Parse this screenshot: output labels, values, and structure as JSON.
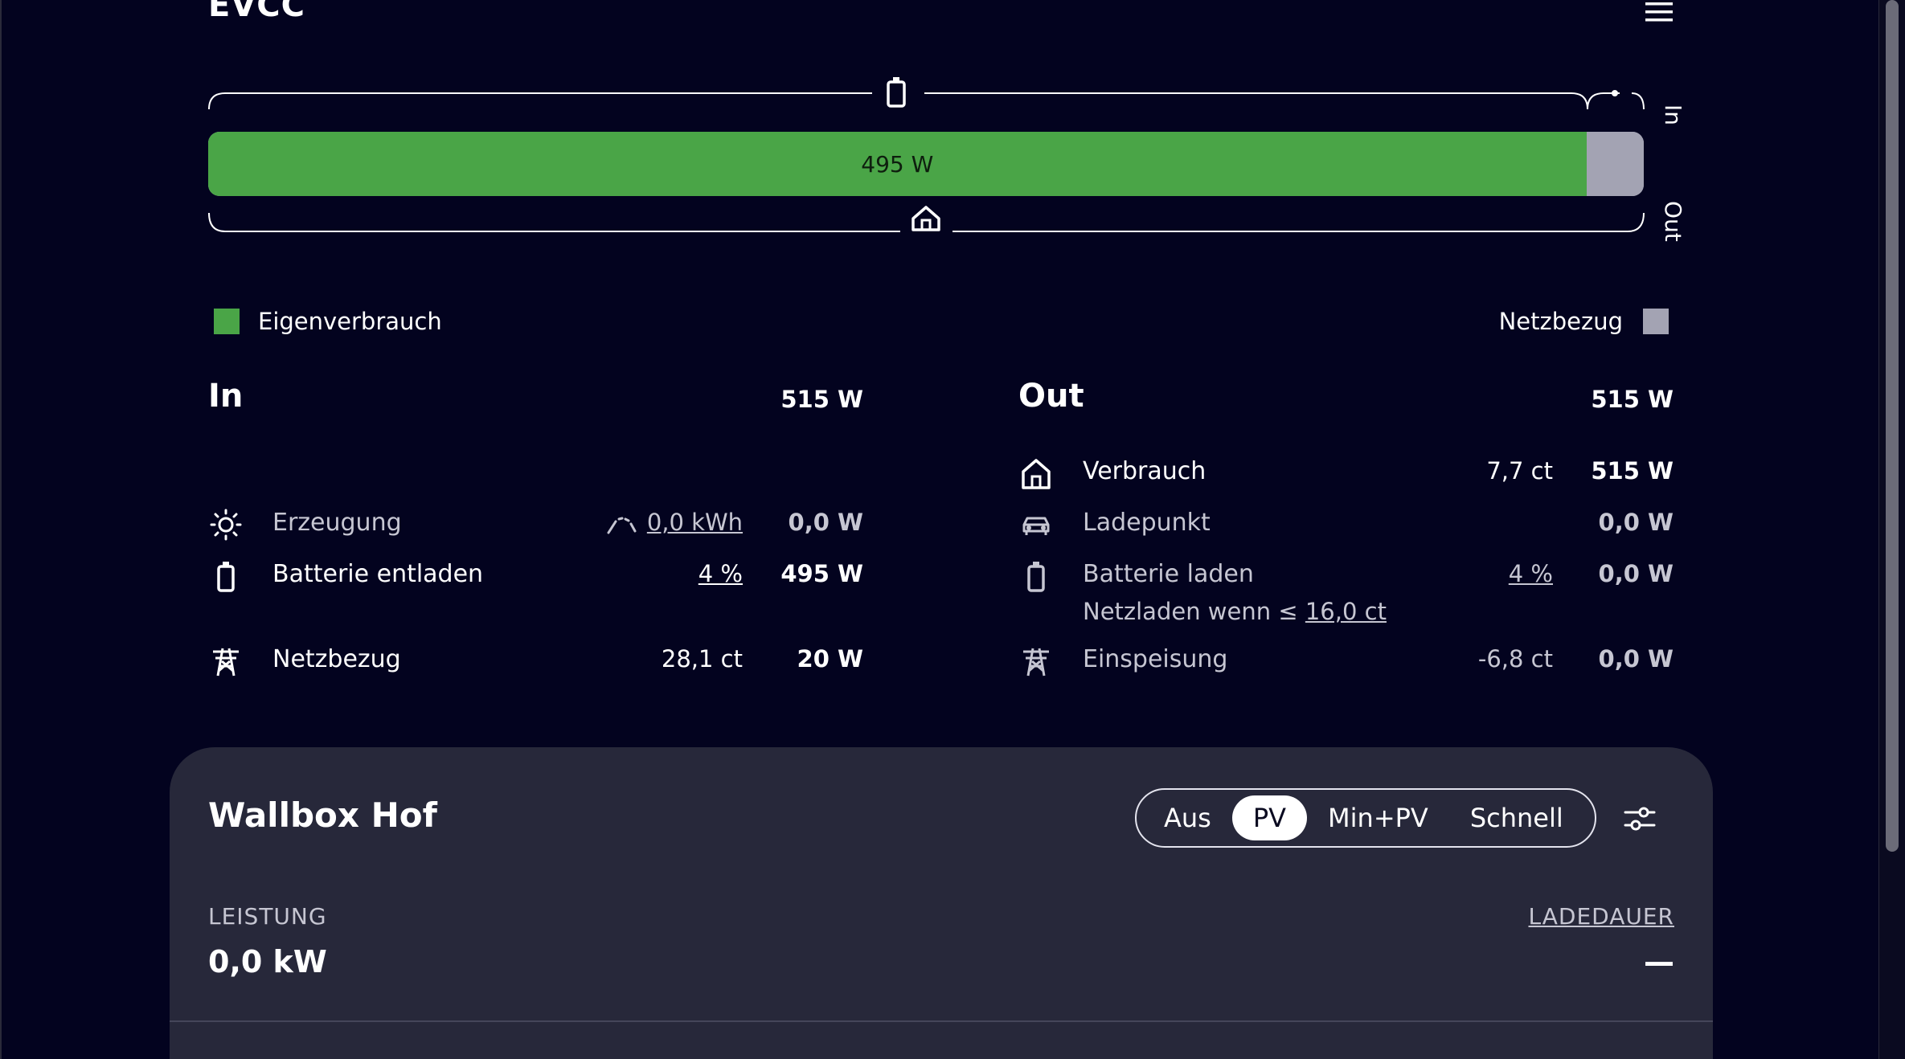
{
  "header": {
    "title": "EVCC",
    "menu_icon": "hamburger-menu-icon"
  },
  "flow": {
    "bar_label": "495 W",
    "self_fraction": 0.96,
    "in_label": "In",
    "out_label": "Out",
    "colors": {
      "self": "#4aa547",
      "grid": "#a3a3b3"
    }
  },
  "legend": {
    "self": "Eigenverbrauch",
    "grid": "Netzbezug"
  },
  "in": {
    "title": "In",
    "total": "515 W",
    "rows": [
      {
        "icon": "sun-icon",
        "label": "Erzeugung",
        "extra": "0,0 kWh",
        "value": "0,0 W"
      },
      {
        "icon": "battery-icon",
        "label": "Batterie entladen",
        "extra": "4 %",
        "value": "495 W"
      },
      {
        "icon": "power-tower-icon",
        "label": "Netzbezug",
        "extra": "28,1 ct",
        "value": "20 W"
      }
    ]
  },
  "out": {
    "title": "Out",
    "total": "515 W",
    "rows": [
      {
        "icon": "home-icon",
        "label": "Verbrauch",
        "extra": "7,7 ct",
        "value": "515 W"
      },
      {
        "icon": "car-icon",
        "label": "Ladepunkt",
        "extra": "",
        "value": "0,0 W"
      },
      {
        "icon": "battery-icon",
        "label": "Batterie laden",
        "extra": "4 %",
        "value": "0,0 W",
        "sub_text": "Netzladen wenn ≤ ",
        "sub_link": "16,0 ct"
      },
      {
        "icon": "power-tower-icon",
        "label": "Einspeisung",
        "extra": "-6,8 ct",
        "value": "0,0 W"
      }
    ]
  },
  "loadpoint": {
    "title": "Wallbox Hof",
    "modes": [
      "Aus",
      "PV",
      "Min+PV",
      "Schnell"
    ],
    "active_mode": "PV",
    "power_label": "LEISTUNG",
    "power_value": "0,0 kW",
    "duration_label": "LADEDAUER",
    "duration_value": "—"
  }
}
